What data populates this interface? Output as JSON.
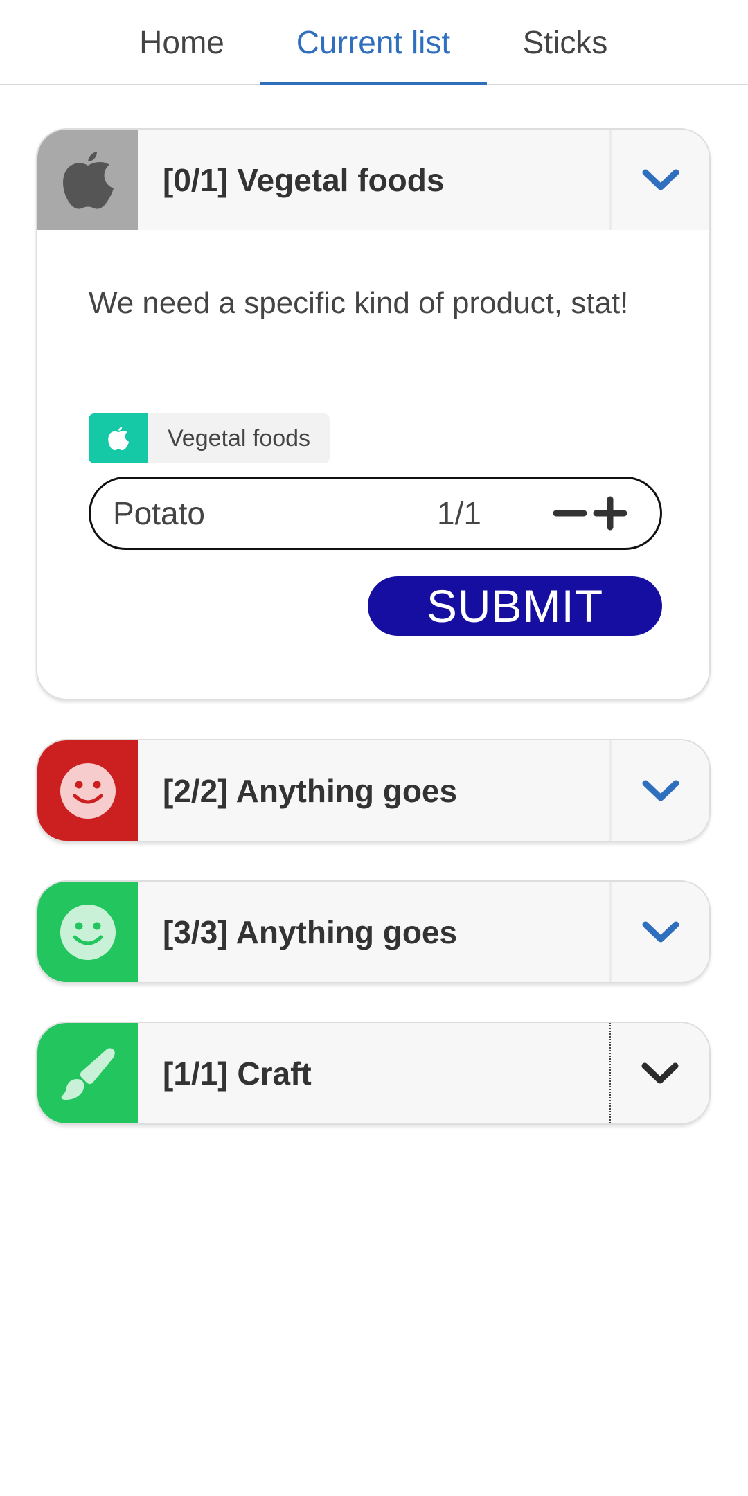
{
  "tabs": {
    "home": "Home",
    "current": "Current list",
    "sticks": "Sticks"
  },
  "cards": [
    {
      "title": "[0/1] Vegetal foods",
      "icon": "apple-icon",
      "icon_bg": "#a9a9a9",
      "expanded": true,
      "description": "We need a specific kind of product, stat!",
      "tag": {
        "label": "Vegetal foods",
        "icon": "apple-icon",
        "color": "#16c9a6"
      },
      "item": {
        "name": "Potato",
        "count": "1/1"
      },
      "submit_label": "SUBMIT"
    },
    {
      "title": "[2/2] Anything goes",
      "icon": "smiley-icon",
      "icon_bg": "#cc1f1f"
    },
    {
      "title": "[3/3] Anything goes",
      "icon": "smiley-icon",
      "icon_bg": "#22c55e"
    },
    {
      "title": "[1/1] Craft",
      "icon": "paintbrush-icon",
      "icon_bg": "#22c55e"
    }
  ],
  "colors": {
    "accent": "#2f6fbe",
    "submit": "#160ea1",
    "chevron": "#2f6fbe"
  }
}
